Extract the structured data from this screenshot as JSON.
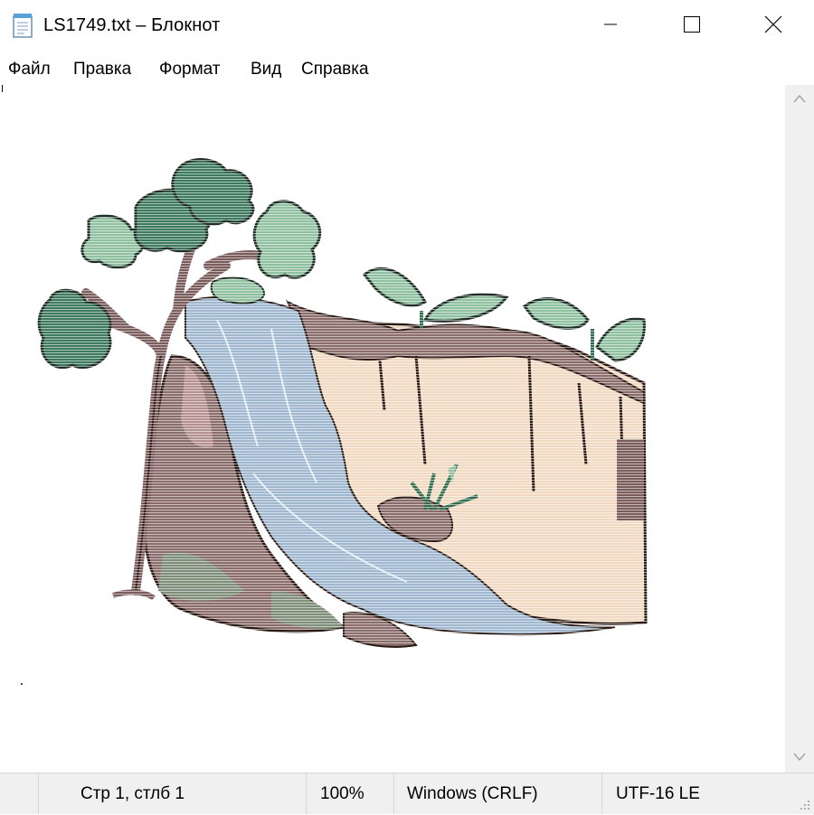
{
  "window": {
    "title": "LS1749.txt – Блокнот",
    "icon": "notepad-icon",
    "controls": [
      "minimize-icon",
      "maximize-icon",
      "close-icon"
    ]
  },
  "menu": {
    "file": "Файл",
    "edit": "Правка",
    "format": "Формат",
    "view": "Вид",
    "help": "Справка"
  },
  "editor": {
    "content_description_icon": "waterfall-ascii-art",
    "colors": {
      "leaf_dark": "#3f7a5f",
      "leaf_light": "#8fc09f",
      "trunk": "#7a5c5a",
      "water": "#9fb8d0",
      "cliff": "#f0d9c0",
      "rock": "#8a6c6a"
    }
  },
  "status": {
    "position": "Стр 1, стлб 1",
    "zoom": "100%",
    "line_ending": "Windows (CRLF)",
    "encoding": "UTF-16 LE"
  }
}
